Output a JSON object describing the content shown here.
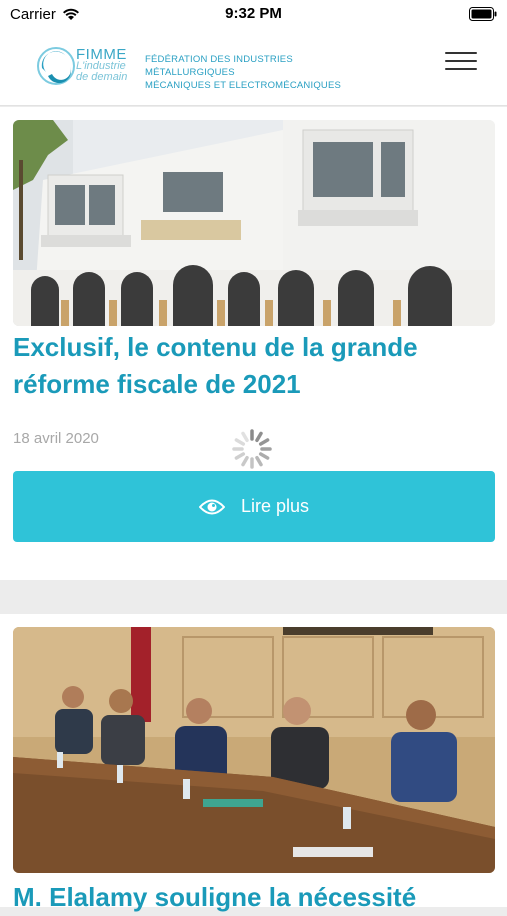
{
  "status_bar": {
    "carrier": "Carrier",
    "time": "9:32 PM"
  },
  "header": {
    "logo_word": "FIMME",
    "logo_tag_line1": "L'industrie",
    "logo_tag_line2": "de demain",
    "federation_line1": "FÉDÉRATION DES INDUSTRIES MÉTALLURGIQUES",
    "federation_line2": "MÉCANIQUES ET ELECTROMÉCANIQUES",
    "menu_icon": "hamburger-icon"
  },
  "articles": [
    {
      "title": "Exclusif, le contenu de la grande réforme fiscale de 2021",
      "date": "18 avril 2020",
      "button_label": "Lire plus",
      "button_icon": "eye-icon"
    },
    {
      "title": "M. Elalamy souligne la nécessité"
    }
  ],
  "colors": {
    "accent": "#1a9ab9",
    "button": "#2fc3d8"
  }
}
